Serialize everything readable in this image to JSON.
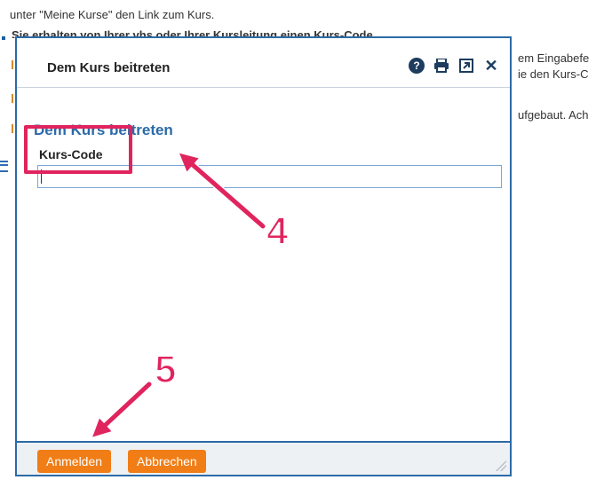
{
  "background": {
    "line1": "unter \"Meine Kurse\" den Link zum Kurs.",
    "line2": "Sie erhalten von Ihrer vhs oder Ihrer Kursleitung einen Kurs-Code",
    "right1": "em Eingabefe",
    "right2": "ie den Kurs-C",
    "right3": "ufgebaut. Ach"
  },
  "dialog": {
    "title": "Dem Kurs beitreten",
    "section_title": "Dem Kurs beitreten",
    "field_label": "Kurs-Code",
    "field_value": "",
    "buttons": {
      "submit": "Anmelden",
      "cancel": "Abbrechen"
    },
    "icons": [
      "help-icon",
      "print-icon",
      "popout-icon",
      "close-icon"
    ]
  },
  "annotations": {
    "step4": "4",
    "step5": "5",
    "color": "#e0245e"
  }
}
